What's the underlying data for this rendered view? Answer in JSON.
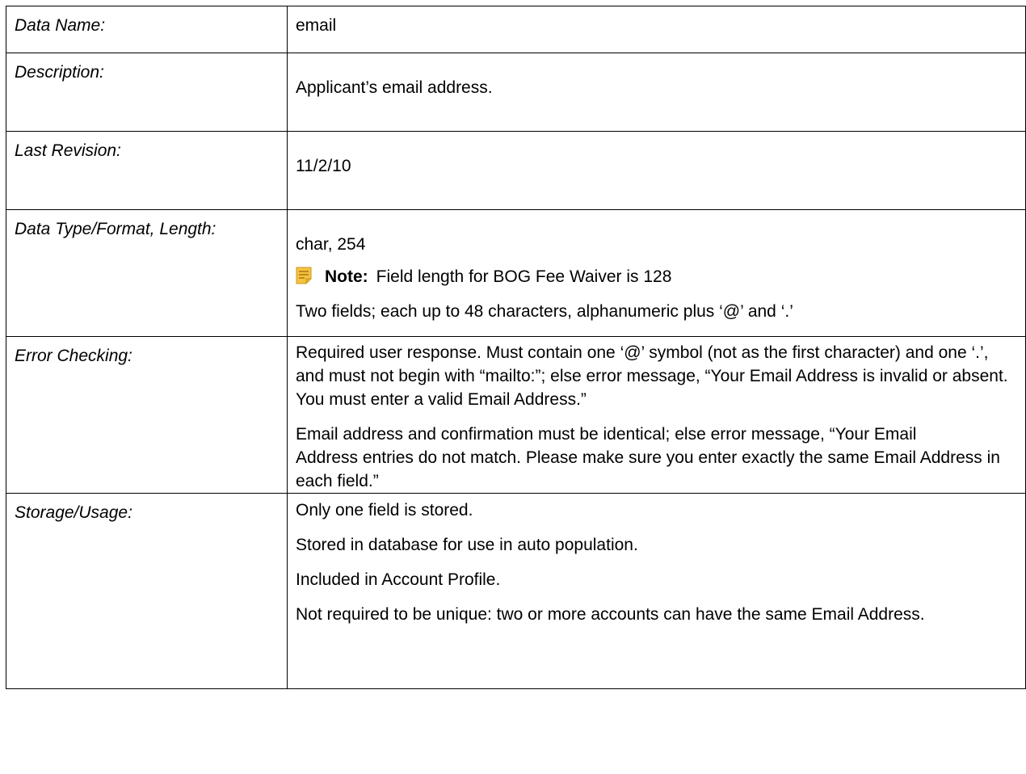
{
  "rows": {
    "data_name": {
      "label": "Data Name:",
      "value": "email"
    },
    "description": {
      "label": "Description:",
      "value": "Applicant’s email address."
    },
    "last_revision": {
      "label": "Last Revision:",
      "value": "11/2/10"
    },
    "data_type": {
      "label": "Data Type/Format, Length:",
      "value": "char, 254",
      "note_icon": "note-icon",
      "note_label": "Note:",
      "note_text": "Field length for BOG Fee Waiver is 128",
      "detail": "Two fields; each up to 48 characters, alphanumeric plus ‘@’ and ‘.’"
    },
    "error_checking": {
      "label": "Error Checking:",
      "paragraph_1": "Required user response. Must contain one ‘@’ symbol (not as the first character) and one ‘.’, and must not begin with “mailto:”; else error message, “Your Email Address is invalid or absent. You must enter a valid Email Address.”",
      "paragraph_2_line_1": "Email address and confirmation must be identical; else error message, “Your Email",
      "paragraph_2_line_2": "Address entries do not match. Please make sure you enter exactly the same Email Address in each field.”"
    },
    "storage_usage": {
      "label": "Storage/Usage:",
      "items": [
        "Only one field is stored.",
        "Stored in database for use in auto population.",
        "Included in Account Profile.",
        "Not required to be unique: two or more accounts can have the same Email Address."
      ]
    }
  },
  "colors": {
    "note_icon_fill": "#F5C342",
    "note_icon_lines": "#B07A10",
    "border": "#000000"
  }
}
